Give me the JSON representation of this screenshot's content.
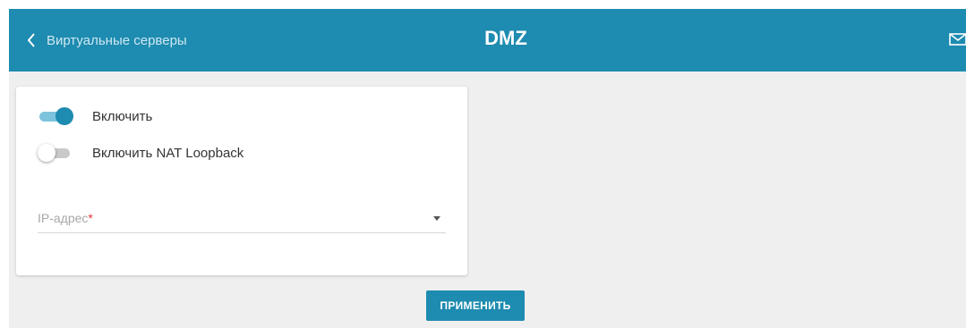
{
  "header": {
    "back_label": "Виртуальные серверы",
    "title": "DMZ",
    "back_icon": "chevron-left-icon",
    "mail_icon": "mail-icon",
    "background": "#1e8bb0"
  },
  "form": {
    "enable": {
      "label": "Включить",
      "checked": true
    },
    "nat_loopback": {
      "label": "Включить NAT Loopback",
      "checked": false
    },
    "ip_address": {
      "placeholder": "IP-адрес",
      "required_mark": "*",
      "value": ""
    }
  },
  "actions": {
    "apply_label": "ПРИМЕНИТЬ"
  },
  "colors": {
    "accent": "#1e8bb0",
    "required": "#e53935"
  }
}
